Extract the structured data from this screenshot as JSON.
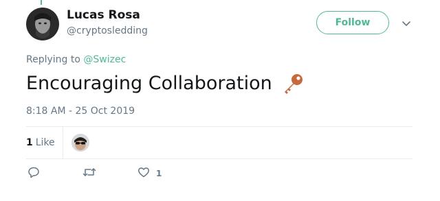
{
  "author": {
    "name": "Lucas Rosa",
    "handle": "@cryptosledding"
  },
  "follow_button": {
    "label": "Follow"
  },
  "replying": {
    "prefix": "Replying to",
    "mention": "@Swizec"
  },
  "tweet": {
    "text": "Encouraging Collaboration",
    "emoji": "key-icon",
    "timestamp": "8:18 AM - 25 Oct 2019"
  },
  "stats": {
    "likes_count": "1",
    "likes_label": "Like"
  },
  "actions": {
    "reply": {
      "icon": "reply-icon",
      "count": ""
    },
    "retweet": {
      "icon": "retweet-icon",
      "count": ""
    },
    "like": {
      "icon": "heart-icon",
      "count": "1"
    }
  },
  "colors": {
    "accent": "#4fb89a",
    "secondary_text": "#657786",
    "primary_text": "#14171a",
    "divider": "#e6ecf0"
  }
}
